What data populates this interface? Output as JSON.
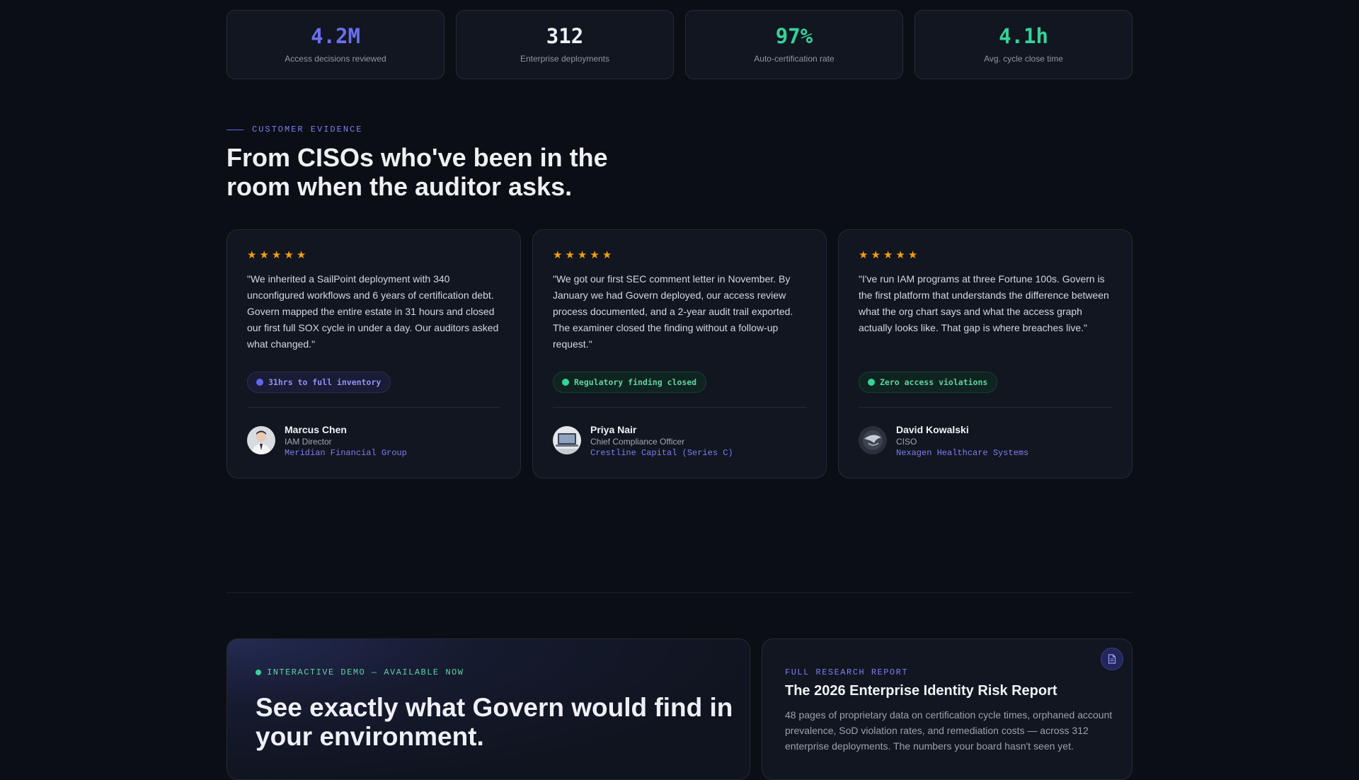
{
  "stats": [
    {
      "value": "4.2M",
      "label": "Access decisions reviewed",
      "color": "#6b6ff0"
    },
    {
      "value": "312",
      "label": "Enterprise deployments",
      "color": "#eef0f5"
    },
    {
      "value": "97%",
      "label": "Auto-certification rate",
      "color": "#34d399"
    },
    {
      "value": "4.1h",
      "label": "Avg. cycle close time",
      "color": "#34d399"
    }
  ],
  "evidence": {
    "eyebrow": "CUSTOMER EVIDENCE",
    "headline": "From CISOs who've been in the room when the auditor asks."
  },
  "testimonials": [
    {
      "rating": 5,
      "quote": "\"We inherited a SailPoint deployment with 340 unconfigured workflows and 6 years of certification debt. Govern mapped the entire estate in 31 hours and closed our first full SOX cycle in under a day. Our auditors asked what changed.\"",
      "badge": "31hrs to full inventory",
      "badge_color": "#6366f1",
      "name": "Marcus Chen",
      "role": "IAM Director",
      "company": "Meridian Financial Group"
    },
    {
      "rating": 5,
      "quote": "\"We got our first SEC comment letter in November. By January we had Govern deployed, our access review process documented, and a 2-year audit trail exported. The examiner closed the finding without a follow-up request.\"",
      "badge": "Regulatory finding closed",
      "badge_color": "#34d399",
      "name": "Priya Nair",
      "role": "Chief Compliance Officer",
      "company": "Crestline Capital (Series C)"
    },
    {
      "rating": 5,
      "quote": "\"I've run IAM programs at three Fortune 100s. Govern is the first platform that understands the difference between what the org chart says and what the access graph actually looks like. That gap is where breaches live.\"",
      "badge": "Zero access violations",
      "badge_color": "#34d399",
      "name": "David Kowalski",
      "role": "CISO",
      "company": "Nexagen Healthcare Systems"
    }
  ],
  "demo": {
    "eyebrow": "INTERACTIVE DEMO — AVAILABLE NOW",
    "title": "See exactly what Govern would find in your environment."
  },
  "report": {
    "icon": "document-icon",
    "eyebrow": "FULL RESEARCH REPORT",
    "title": "The 2026 Enterprise Identity Risk Report",
    "description": "48 pages of proprietary data on certification cycle times, orphaned account prevalence, SoD violation rates, and remediation costs — across 312 enterprise deployments. The numbers your board hasn't seen yet."
  }
}
